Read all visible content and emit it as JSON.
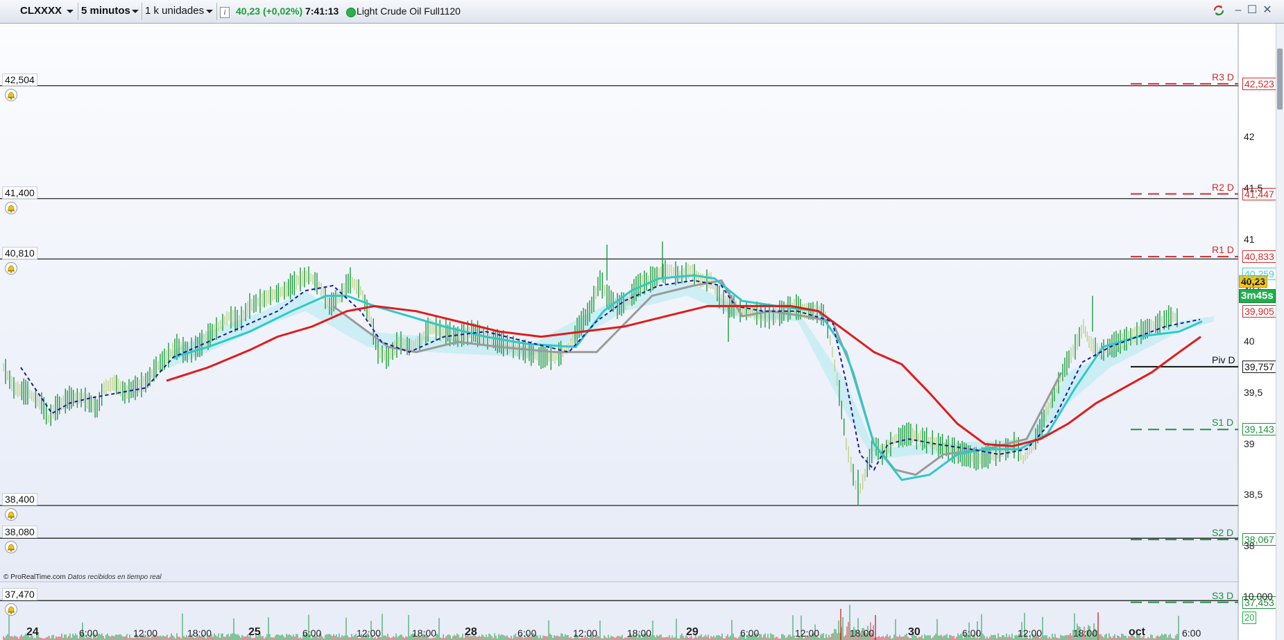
{
  "toolbar": {
    "symbol": "CLXXXX",
    "timeframe": "5 minutos",
    "units": "1 k unidades",
    "price": "40,23",
    "change": "(+0,02%)",
    "time": "7:41:13",
    "instrument_name": "Light Crude Oil Full1120",
    "info_icon": "i"
  },
  "alert_lines": [
    {
      "label": "42,504",
      "value": 42.504
    },
    {
      "label": "41,400",
      "value": 41.4
    },
    {
      "label": "40,810",
      "value": 40.81
    },
    {
      "label": "38,400",
      "value": 38.4
    },
    {
      "label": "38,080",
      "value": 38.08
    },
    {
      "label": "37,470",
      "value": 37.47
    }
  ],
  "pivots": [
    {
      "name": "R3 D",
      "tag": "42,523",
      "value": 42.523,
      "color": "#d22b2b"
    },
    {
      "name": "R2 D",
      "tag": "41,447",
      "value": 41.447,
      "color": "#d22b2b"
    },
    {
      "name": "R1 D",
      "tag": "40,833",
      "value": 40.833,
      "color": "#d22b2b"
    },
    {
      "name": "Piv D",
      "tag": "39,757",
      "value": 39.757,
      "color": "#111111"
    },
    {
      "name": "S1 D",
      "tag": "39,143",
      "value": 39.143,
      "color": "#1f8f3a"
    },
    {
      "name": "S2 D",
      "tag": "38,067",
      "value": 38.067,
      "color": "#1f8f3a"
    },
    {
      "name": "S3 D",
      "tag": "37,453",
      "value": 37.453,
      "color": "#1f8f3a"
    }
  ],
  "price_axis": {
    "ticks": [
      "42",
      "41,5",
      "41",
      "40,5",
      "40",
      "39,5",
      "39",
      "38,5",
      "38"
    ],
    "current_price_tag": "40,23",
    "countdown": "3m45s",
    "tag_39905": "39,905",
    "tag_40259": "40,259"
  },
  "volume_axis": {
    "ticks": [
      "10.000",
      "20"
    ]
  },
  "time_axis": [
    "24",
    "6:00",
    "12:00",
    "18:00",
    "25",
    "6:00",
    "12:00",
    "18:00",
    "28",
    "6:00",
    "12:00",
    "18:00",
    "29",
    "6:00",
    "12:00",
    "18:00",
    "30",
    "6:00",
    "12:00",
    "18:00",
    "oct",
    "6:00"
  ],
  "footer": {
    "copyright": "© ProRealTime.com",
    "status": "Datos recibidos en tiempo real"
  },
  "colors": {
    "price_up": "#1a9c3a",
    "ma_slow": "#e01b1b",
    "ma_fast": "#2ec9c9",
    "ma_grey": "#9a9a9a",
    "dashed": "#1a1a9c",
    "bg": "#f2f4fb"
  },
  "icons": [
    "bell-icon",
    "chevron-down-icon",
    "info-icon",
    "status-dot-icon",
    "minimize-icon",
    "restore-icon",
    "close-icon",
    "sync-icon"
  ]
}
